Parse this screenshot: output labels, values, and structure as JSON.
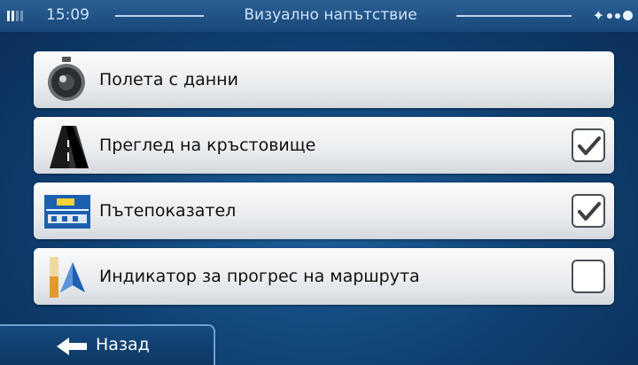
{
  "status": {
    "time": "15:09",
    "title": "Визуално напътствие"
  },
  "items": [
    {
      "label": "Полета с данни",
      "icon": "stopwatch-icon",
      "has_checkbox": false
    },
    {
      "label": "Преглед на кръстовище",
      "icon": "road-junction-icon",
      "checked": true
    },
    {
      "label": "Пътепоказател",
      "icon": "road-sign-icon",
      "checked": true
    },
    {
      "label": "Индикатор за прогрес на маршрута",
      "icon": "route-progress-icon",
      "checked": false
    }
  ],
  "back": {
    "label": "Назад"
  },
  "colors": {
    "background": "#0f3f70",
    "item": "#eceff1",
    "accent": "#2a5f95"
  }
}
